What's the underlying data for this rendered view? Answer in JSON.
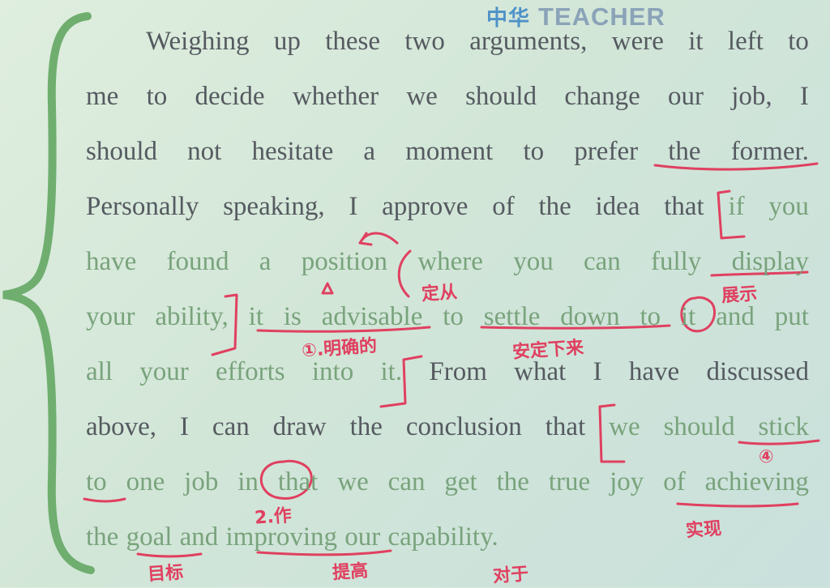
{
  "logo": {
    "mark": "中华",
    "text": "TEACHER"
  },
  "lines": [
    [
      {
        "t": "Weighing",
        "c": "w"
      },
      {
        "t": "up",
        "c": "w"
      },
      {
        "t": "these",
        "c": "w"
      },
      {
        "t": "two",
        "c": "w"
      },
      {
        "t": "arguments,",
        "c": "w"
      },
      {
        "t": "were",
        "c": "w"
      },
      {
        "t": "it",
        "c": "w"
      },
      {
        "t": "left",
        "c": "w"
      },
      {
        "t": "to",
        "c": "w"
      }
    ],
    [
      {
        "t": "me",
        "c": "w"
      },
      {
        "t": "to",
        "c": "w"
      },
      {
        "t": "decide",
        "c": "w"
      },
      {
        "t": "whether",
        "c": "w"
      },
      {
        "t": "we",
        "c": "w"
      },
      {
        "t": "should",
        "c": "w"
      },
      {
        "t": "change",
        "c": "w"
      },
      {
        "t": "our",
        "c": "w"
      },
      {
        "t": "job,",
        "c": "w"
      },
      {
        "t": "I",
        "c": "w"
      }
    ],
    [
      {
        "t": "should",
        "c": "w"
      },
      {
        "t": "not",
        "c": "w"
      },
      {
        "t": "hesitate",
        "c": "w"
      },
      {
        "t": "a",
        "c": "w"
      },
      {
        "t": "moment",
        "c": "w"
      },
      {
        "t": "to",
        "c": "w"
      },
      {
        "t": "prefer",
        "c": "w"
      },
      {
        "t": "the",
        "c": "w"
      },
      {
        "t": "former.",
        "c": "w"
      }
    ],
    [
      {
        "t": "Personally",
        "c": "w"
      },
      {
        "t": "speaking,",
        "c": "w"
      },
      {
        "t": "I",
        "c": "w"
      },
      {
        "t": "approve",
        "c": "w"
      },
      {
        "t": "of",
        "c": "w"
      },
      {
        "t": "the",
        "c": "w"
      },
      {
        "t": "idea",
        "c": "w"
      },
      {
        "t": "that",
        "c": "w"
      },
      {
        "t": "if",
        "c": "g"
      },
      {
        "t": "you",
        "c": "g"
      }
    ],
    [
      {
        "t": "have",
        "c": "g"
      },
      {
        "t": "found",
        "c": "g"
      },
      {
        "t": "a",
        "c": "g"
      },
      {
        "t": "position",
        "c": "g"
      },
      {
        "t": "where",
        "c": "g"
      },
      {
        "t": "you",
        "c": "g"
      },
      {
        "t": "can",
        "c": "g"
      },
      {
        "t": "fully",
        "c": "g"
      },
      {
        "t": "display",
        "c": "g"
      }
    ],
    [
      {
        "t": "your",
        "c": "g"
      },
      {
        "t": "ability,",
        "c": "g"
      },
      {
        "t": "it",
        "c": "g"
      },
      {
        "t": "is",
        "c": "g"
      },
      {
        "t": "advisable",
        "c": "g"
      },
      {
        "t": "to",
        "c": "g"
      },
      {
        "t": "settle",
        "c": "g"
      },
      {
        "t": "down",
        "c": "g"
      },
      {
        "t": "to",
        "c": "g"
      },
      {
        "t": "it",
        "c": "g"
      },
      {
        "t": "and",
        "c": "g"
      },
      {
        "t": "put",
        "c": "g"
      }
    ],
    [
      {
        "t": "all",
        "c": "g"
      },
      {
        "t": "your",
        "c": "g"
      },
      {
        "t": "efforts",
        "c": "g"
      },
      {
        "t": "into",
        "c": "g"
      },
      {
        "t": "it.",
        "c": "g"
      },
      {
        "t": "From",
        "c": "w"
      },
      {
        "t": "what",
        "c": "w"
      },
      {
        "t": "I",
        "c": "w"
      },
      {
        "t": "have",
        "c": "w"
      },
      {
        "t": "discussed",
        "c": "w"
      }
    ],
    [
      {
        "t": "above,",
        "c": "w"
      },
      {
        "t": "I",
        "c": "w"
      },
      {
        "t": "can",
        "c": "w"
      },
      {
        "t": "draw",
        "c": "w"
      },
      {
        "t": "the",
        "c": "w"
      },
      {
        "t": "conclusion",
        "c": "w"
      },
      {
        "t": "that",
        "c": "w"
      },
      {
        "t": "we",
        "c": "g"
      },
      {
        "t": "should",
        "c": "g"
      },
      {
        "t": "stick",
        "c": "g"
      }
    ],
    [
      {
        "t": "to",
        "c": "g"
      },
      {
        "t": "one",
        "c": "g"
      },
      {
        "t": "job",
        "c": "g"
      },
      {
        "t": "in",
        "c": "g"
      },
      {
        "t": "that",
        "c": "g"
      },
      {
        "t": "we",
        "c": "g"
      },
      {
        "t": "can",
        "c": "g"
      },
      {
        "t": "get",
        "c": "g"
      },
      {
        "t": "the",
        "c": "g"
      },
      {
        "t": "true",
        "c": "g"
      },
      {
        "t": "joy",
        "c": "g"
      },
      {
        "t": "of",
        "c": "g"
      },
      {
        "t": "achieving",
        "c": "g"
      }
    ],
    [
      {
        "t": "the",
        "c": "g"
      },
      {
        "t": "goal",
        "c": "g"
      },
      {
        "t": "and",
        "c": "g"
      },
      {
        "t": "improving",
        "c": "g"
      },
      {
        "t": "our",
        "c": "g"
      },
      {
        "t": "capability.",
        "c": "g"
      }
    ]
  ],
  "annotations": {
    "dingcong": "定从",
    "mingque": "①.明确的",
    "zhanshi": "展示",
    "anding": "安定下来",
    "circle_four": "④",
    "num_two": "2.作",
    "shixian": "实现",
    "mubiao": "目标",
    "tigao": "提高",
    "duiyu": "对于"
  },
  "colors": {
    "ink": "#e04060",
    "green_text": "#79a37c",
    "dark_text": "#555a60",
    "brace": "#6fae6f"
  }
}
